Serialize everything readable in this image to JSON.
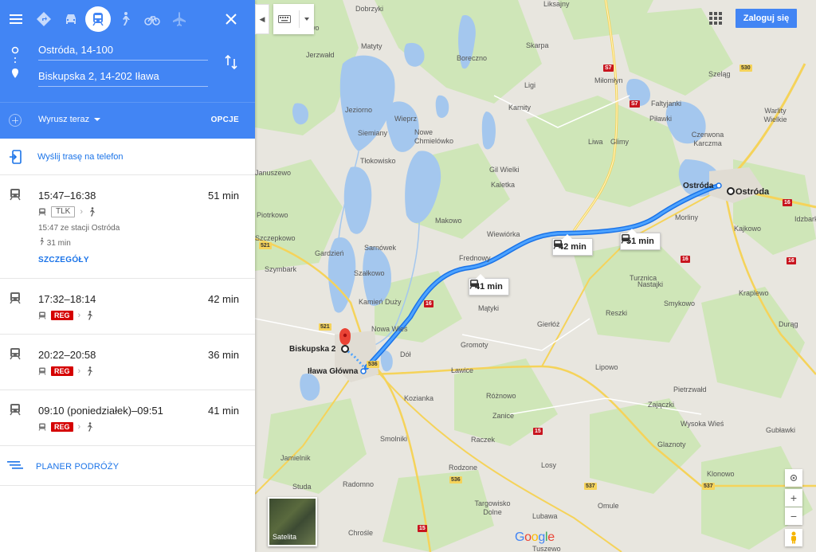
{
  "header": {
    "origin": "Ostróda, 14-100",
    "destination": "Biskupska 2, 14-202 Iława",
    "depart": "Wyrusz teraz",
    "options": "OPCJE",
    "modes": [
      "directions-icon",
      "car-icon",
      "transit-icon",
      "walk-icon",
      "bike-icon",
      "flight-icon"
    ]
  },
  "send_to_phone": "Wyślij trasę na telefon",
  "trips": [
    {
      "time": "15:47–16:38",
      "duration": "51 min",
      "badge": "TLK",
      "station": "15:47 ze stacji Ostróda",
      "walk": "31 min",
      "details": "SZCZEGÓŁY"
    },
    {
      "time": "17:32–18:14",
      "duration": "42 min",
      "badge": "REG"
    },
    {
      "time": "20:22–20:58",
      "duration": "36 min",
      "badge": "REG"
    },
    {
      "time": "09:10 (poniedziałek)–09:51",
      "duration": "41 min",
      "badge": "REG"
    }
  ],
  "planner": "PLANER PODRÓŻY",
  "login": "Zaloguj się",
  "satellite": "Satelita",
  "google": "Google",
  "map": {
    "route_labels": [
      "51 min",
      "42 min",
      "41 min"
    ],
    "endpoints": {
      "origin": "Ostróda",
      "dest": "Biskupska 2",
      "station": "Iława Główna",
      "origin_small": "Ostróda"
    },
    "places": [
      "Dobrzyki",
      "Liksajny",
      "Rucewo",
      "Matyty",
      "Jerzwałd",
      "Skarpa",
      "Boreczno",
      "Ligi",
      "Miłomłyn",
      "Szeląg",
      "Karnity",
      "Faltyjanki",
      "Jeziorno",
      "Wieprz",
      "Siemiany",
      "Nowe Chmielówko",
      "Piławki",
      "Warlity Wielkie",
      "Czerwona Karczma",
      "Liwa",
      "Glimy",
      "Tłokowisko",
      "Gil Wielki",
      "Kaletka",
      "Makowo",
      "Wiewiórka",
      "Piotrkowo",
      "Sarnówek",
      "Frednowy",
      "Gardzień",
      "Szczepkowo",
      "Szymbark",
      "Szałkowo",
      "Kamień Duży",
      "Mątyki",
      "Gierłóż",
      "Turznica",
      "Nastajki",
      "Smykowo",
      "Reszki",
      "Kraplewo",
      "Durąg",
      "Kajkowo",
      "Morliny",
      "Idzbark",
      "Nowa Wieś",
      "Dół",
      "Gromoty",
      "Ławice",
      "Lipowo",
      "Pietrzwałd",
      "Różnowo",
      "Zajączki",
      "Kozianka",
      "Wysoka Wieś",
      "Gubławki",
      "Raczek",
      "Glaznoty",
      "Smolniki",
      "Jamielnik",
      "Rodzone",
      "Losy",
      "Klonowo",
      "Studa",
      "Radomno",
      "Targowisko Dolne",
      "Lubawa",
      "Omule",
      "Tuszewo",
      "Chrośle",
      "Zanice",
      "Januszewo",
      "Szymbark"
    ],
    "roads": [
      "S7",
      "S7",
      "530",
      "16",
      "16",
      "521",
      "521",
      "16",
      "536",
      "536",
      "15",
      "15",
      "537",
      "537",
      "15",
      "16"
    ]
  }
}
